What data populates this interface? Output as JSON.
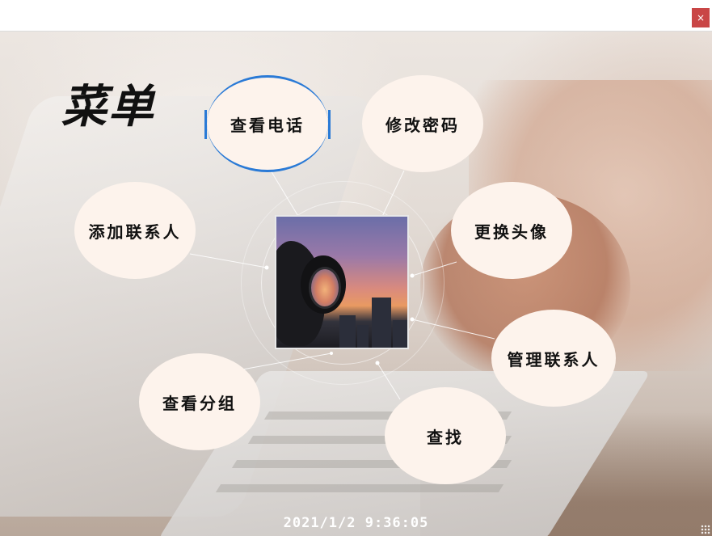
{
  "window": {
    "close_label": "×"
  },
  "menu": {
    "title": "菜单",
    "items": [
      {
        "id": "view-phone",
        "label": "查看电话",
        "active": true
      },
      {
        "id": "change-password",
        "label": "修改密码",
        "active": false
      },
      {
        "id": "add-contact",
        "label": "添加联系人",
        "active": false
      },
      {
        "id": "change-avatar",
        "label": "更换头像",
        "active": false
      },
      {
        "id": "manage-contacts",
        "label": "管理联系人",
        "active": false
      },
      {
        "id": "view-groups",
        "label": "查看分组",
        "active": false
      },
      {
        "id": "search",
        "label": "查找",
        "active": false
      }
    ]
  },
  "status": {
    "datetime": "2021/1/2  9:36:05"
  },
  "colors": {
    "accent": "#2a7ad6",
    "close_button": "#c94646",
    "bubble_fill": "#fdf3ec"
  },
  "icons": {
    "close": "close-icon",
    "resize": "resize-grip-icon"
  }
}
